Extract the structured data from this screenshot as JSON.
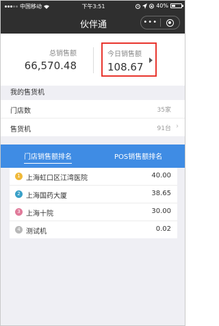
{
  "status_bar": {
    "carrier": "中国移动",
    "time": "下午3:51",
    "battery": "40%",
    "battery_level": 0.4
  },
  "nav": {
    "title": "伙伴通",
    "more_label": "•••",
    "more_icon": "more-dots-icon",
    "close_icon": "close-circle-icon"
  },
  "summary": {
    "total_label": "总销售额",
    "total_value": "66,570.48",
    "today_label": "今日销售额",
    "today_value": "108.67",
    "highlight_color": "#e8352e"
  },
  "vending": {
    "section_title": "我的售货机",
    "rows": [
      {
        "label": "门店数",
        "value": "35家"
      },
      {
        "label": "售货机",
        "value": "91台"
      }
    ]
  },
  "ranking": {
    "tabs": [
      {
        "label": "门店销售额排名",
        "active": true
      },
      {
        "label": "POS销售额排名",
        "active": false
      }
    ],
    "tab_bar_color": "#3f8ce4",
    "items": [
      {
        "rank": "1",
        "color": "#f0b93a",
        "name": "上海虹口区江湾医院",
        "value": "40.00"
      },
      {
        "rank": "2",
        "color": "#39a0c8",
        "name": "上海国药大厦",
        "value": "38.65"
      },
      {
        "rank": "3",
        "color": "#e07a9a",
        "name": "上海十院",
        "value": "30.00"
      },
      {
        "rank": "4",
        "color": "#b8b8b8",
        "name": "测试机",
        "value": "0.02"
      }
    ]
  }
}
